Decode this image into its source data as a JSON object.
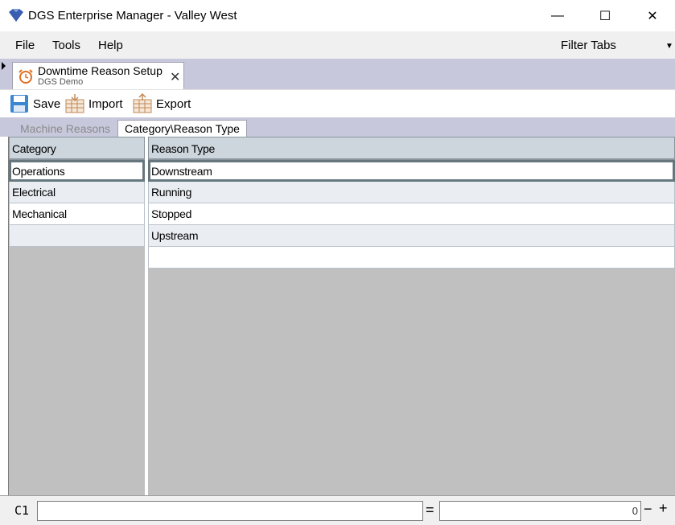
{
  "window": {
    "title": "DGS Enterprise Manager - Valley West",
    "minimize_glyph": "—",
    "maximize_glyph": "☐",
    "close_glyph": "✕"
  },
  "menu": {
    "items": [
      "File",
      "Tools",
      "Help"
    ],
    "filter_tabs_label": "Filter Tabs",
    "filter_tabs_arrow": "▼"
  },
  "doc_tab": {
    "title": "Downtime Reason Setup",
    "subtitle": "DGS Demo",
    "close_glyph": "✕",
    "icon": "alarm-clock-icon"
  },
  "toolbar": {
    "save_label": "Save",
    "import_label": "Import",
    "export_label": "Export"
  },
  "inner_tabs": {
    "machine_reasons": "Machine Reasons",
    "category_reason_type": "Category\\Reason Type",
    "active": "Category\\Reason Type"
  },
  "category_grid": {
    "header": "Category",
    "rows": [
      "Operations",
      "Electrical",
      "Mechanical",
      ""
    ]
  },
  "reason_grid": {
    "header": "Reason Type",
    "rows": [
      "Downstream",
      "Running",
      "Stopped",
      "Upstream",
      ""
    ]
  },
  "formula_bar": {
    "cell_ref": "C1",
    "formula": "",
    "equals": "=",
    "value": "0",
    "minus": "−",
    "plus": "+"
  },
  "colors": {
    "tabstrip": "#c8c8dc",
    "grid_header": "#cdd5dd",
    "grid_bg": "#c0c0c0",
    "row_alt": "#eaeef3"
  }
}
